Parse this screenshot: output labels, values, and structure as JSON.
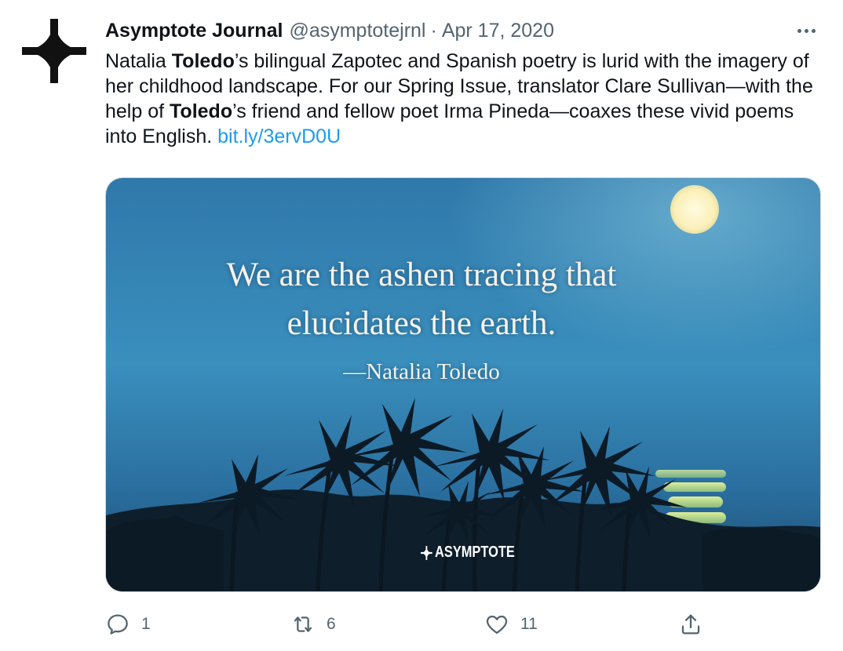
{
  "tweet": {
    "author_name": "Asymptote Journal",
    "handle": "@asymptotejrnl",
    "separator": "·",
    "date": "Apr 17, 2020",
    "text_parts": {
      "p1": "Natalia ",
      "p2": "Toledo",
      "p3": "’s bilingual Zapotec and Spanish poetry is lurid with the imagery of her childhood landscape. For our Spring Issue, translator Clare Sullivan—with the help of ",
      "p4": "Toledo",
      "p5": "’s friend and fellow poet Irma Pineda—coaxes these vivid poems into English. ",
      "link": "bit.ly/3ervD0U"
    },
    "image": {
      "quote_line_1": "We are the ashen tracing that",
      "quote_line_2": "elucidates the earth.",
      "attribution": "—Natalia Toledo",
      "brand": "ASYMPTOTE"
    },
    "actions": {
      "reply_count": "1",
      "retweet_count": "6",
      "like_count": "11"
    }
  },
  "colors": {
    "link": "#1d9bf0",
    "muted": "#536471",
    "text": "#0f1419"
  },
  "icons": {
    "avatar": "asymptote-star-logo",
    "more": "more-dots-icon",
    "reply": "reply-bubble-icon",
    "retweet": "retweet-icon",
    "like": "heart-icon",
    "share": "share-icon"
  }
}
